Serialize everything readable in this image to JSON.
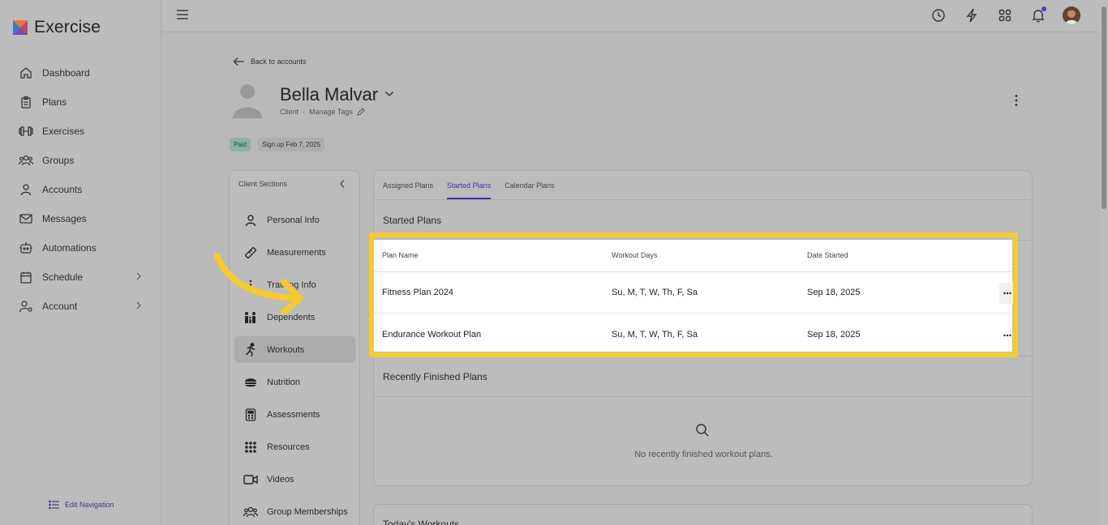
{
  "app": {
    "name": "Exercise"
  },
  "sidebar": {
    "items": [
      {
        "label": "Dashboard",
        "icon": "home-icon"
      },
      {
        "label": "Plans",
        "icon": "clipboard-icon"
      },
      {
        "label": "Exercises",
        "icon": "dumbbell-icon"
      },
      {
        "label": "Groups",
        "icon": "groups-icon"
      },
      {
        "label": "Accounts",
        "icon": "user-icon"
      },
      {
        "label": "Messages",
        "icon": "mail-icon"
      },
      {
        "label": "Automations",
        "icon": "robot-icon"
      },
      {
        "label": "Schedule",
        "icon": "calendar-icon"
      },
      {
        "label": "Account",
        "icon": "user-gear-icon"
      }
    ],
    "edit_nav": "Edit Navigation"
  },
  "header": {
    "back_label": "Back to accounts",
    "client_name": "Bella Malvar",
    "client_role": "Client",
    "separator": "·",
    "manage_tags": "Manage Tags",
    "badge_paid": "Paid",
    "badge_signup": "Sign up Feb 7, 2025"
  },
  "sections": {
    "title": "Client Sections",
    "items": [
      {
        "label": "Personal Info",
        "icon": "person-icon"
      },
      {
        "label": "Measurements",
        "icon": "ruler-icon"
      },
      {
        "label": "Training Info",
        "icon": "info-icon"
      },
      {
        "label": "Dependents",
        "icon": "family-icon"
      },
      {
        "label": "Workouts",
        "icon": "running-icon",
        "active": true
      },
      {
        "label": "Nutrition",
        "icon": "food-icon"
      },
      {
        "label": "Assessments",
        "icon": "calculator-icon"
      },
      {
        "label": "Resources",
        "icon": "grid-icon"
      },
      {
        "label": "Videos",
        "icon": "video-icon"
      },
      {
        "label": "Group Memberships",
        "icon": "groups-icon"
      }
    ]
  },
  "tabs": [
    {
      "label": "Assigned Plans"
    },
    {
      "label": "Started Plans",
      "active": true
    },
    {
      "label": "Calendar Plans"
    }
  ],
  "started_plans": {
    "title": "Started Plans",
    "columns": [
      "Plan Name",
      "Workout Days",
      "Date Started"
    ],
    "rows": [
      {
        "name": "Fitness Plan 2024",
        "days": "Su, M, T, W, Th, F, Sa",
        "date": "Sep 18, 2025"
      },
      {
        "name": "Endurance Workout Plan",
        "days": "Su, M, T, W, Th, F, Sa",
        "date": "Sep 18, 2025"
      }
    ]
  },
  "finished_plans": {
    "title": "Recently Finished Plans",
    "empty_text": "No recently finished workout plans."
  },
  "todays_workouts": {
    "title": "Today's Workouts"
  },
  "colors": {
    "accent": "#3b35a0",
    "highlight": "#f7c930",
    "notification": "#4b3be0"
  }
}
